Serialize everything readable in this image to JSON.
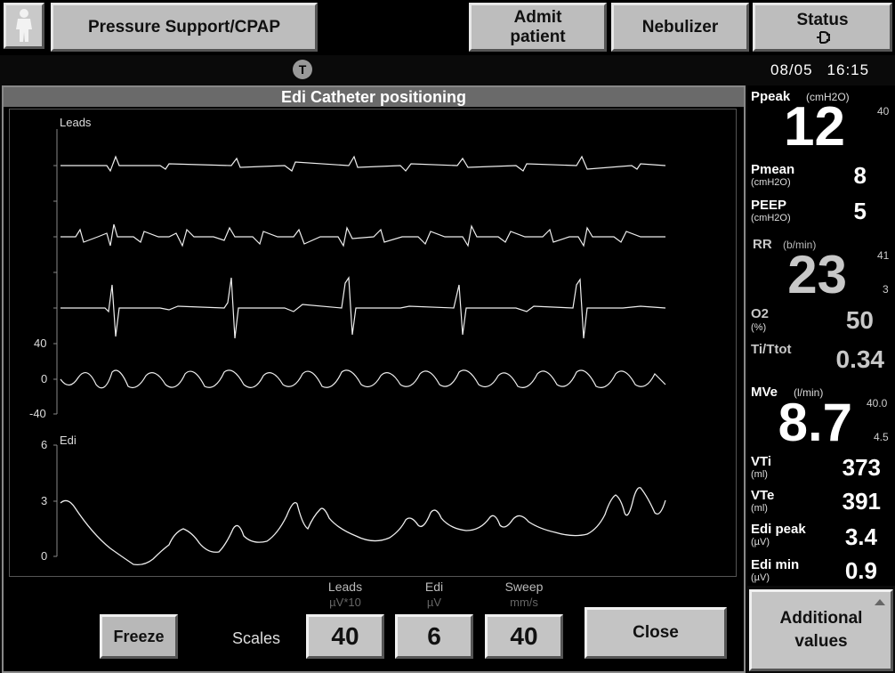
{
  "topbar": {
    "mode_label": "Pressure Support/CPAP",
    "admit_line1": "Admit",
    "admit_line2": "patient",
    "nebulizer_label": "Nebulizer",
    "status_label": "Status",
    "status_icon": "plug-icon"
  },
  "statusline": {
    "clock_glyph": "T",
    "date": "08/05",
    "time": "16:15"
  },
  "panel": {
    "title": "Edi Catheter positioning",
    "leads_label": "Leads",
    "edi_label": "Edi",
    "leads_axis": [
      "40",
      "0",
      "-40"
    ],
    "edi_axis": [
      "6",
      "3",
      "0"
    ]
  },
  "controls": {
    "freeze_label": "Freeze",
    "scales_label": "Scales",
    "close_label": "Close",
    "scales": [
      {
        "name": "Leads",
        "unit": "µV*10",
        "value": "40"
      },
      {
        "name": "Edi",
        "unit": "µV",
        "value": "6"
      },
      {
        "name": "Sweep",
        "unit": "mm/s",
        "value": "40"
      }
    ]
  },
  "values": {
    "ppeak": {
      "name": "Ppeak",
      "unit": "(cmH2O)",
      "value": "12",
      "limit": "40"
    },
    "pmean": {
      "name": "Pmean",
      "unit": "(cmH2O)",
      "value": "8"
    },
    "peep": {
      "name": "PEEP",
      "unit": "(cmH2O)",
      "value": "5"
    },
    "rr": {
      "name": "RR",
      "unit": "(b/min)",
      "value": "23",
      "upper": "41",
      "lower": "3"
    },
    "o2": {
      "name": "O2",
      "unit": "(%)",
      "value": "50"
    },
    "titot": {
      "name": "Ti/Ttot",
      "value": "0.34"
    },
    "mve": {
      "name": "MVe",
      "unit": "(l/min)",
      "value": "8.7",
      "upper": "40.0",
      "lower": "4.5"
    },
    "vti": {
      "name": "VTi",
      "unit": "(ml)",
      "value": "373"
    },
    "vte": {
      "name": "VTe",
      "unit": "(ml)",
      "value": "391"
    },
    "edipeak": {
      "name": "Edi peak",
      "unit": "(µV)",
      "value": "3.4"
    },
    "edimin": {
      "name": "Edi min",
      "unit": "(µV)",
      "value": "0.9"
    }
  },
  "additional": {
    "line1": "Additional",
    "line2": "values"
  }
}
